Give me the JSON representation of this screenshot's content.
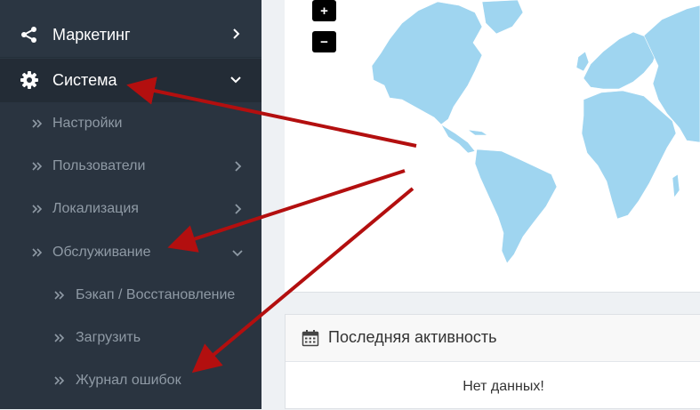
{
  "sidebar": {
    "marketing": {
      "label": "Маркетинг",
      "icon": "share-icon"
    },
    "system": {
      "label": "Система",
      "icon": "gear-icon"
    },
    "system_items": [
      {
        "label": "Настройки"
      },
      {
        "label": "Пользователи"
      },
      {
        "label": "Локализация"
      },
      {
        "label": "Обслуживание"
      }
    ],
    "maintenance_items": [
      {
        "label": "Бэкап / Восстановление"
      },
      {
        "label": "Загрузить"
      },
      {
        "label": "Журнал ошибок"
      }
    ]
  },
  "map": {
    "zoom_in_label": "+",
    "zoom_out_label": "−"
  },
  "activity": {
    "title": "Последняя активность",
    "empty_text": "Нет данных!"
  },
  "colors": {
    "sidebar_bg": "#2b3642",
    "map_land": "#9fd5f0",
    "arrow": "#b30f0f"
  }
}
